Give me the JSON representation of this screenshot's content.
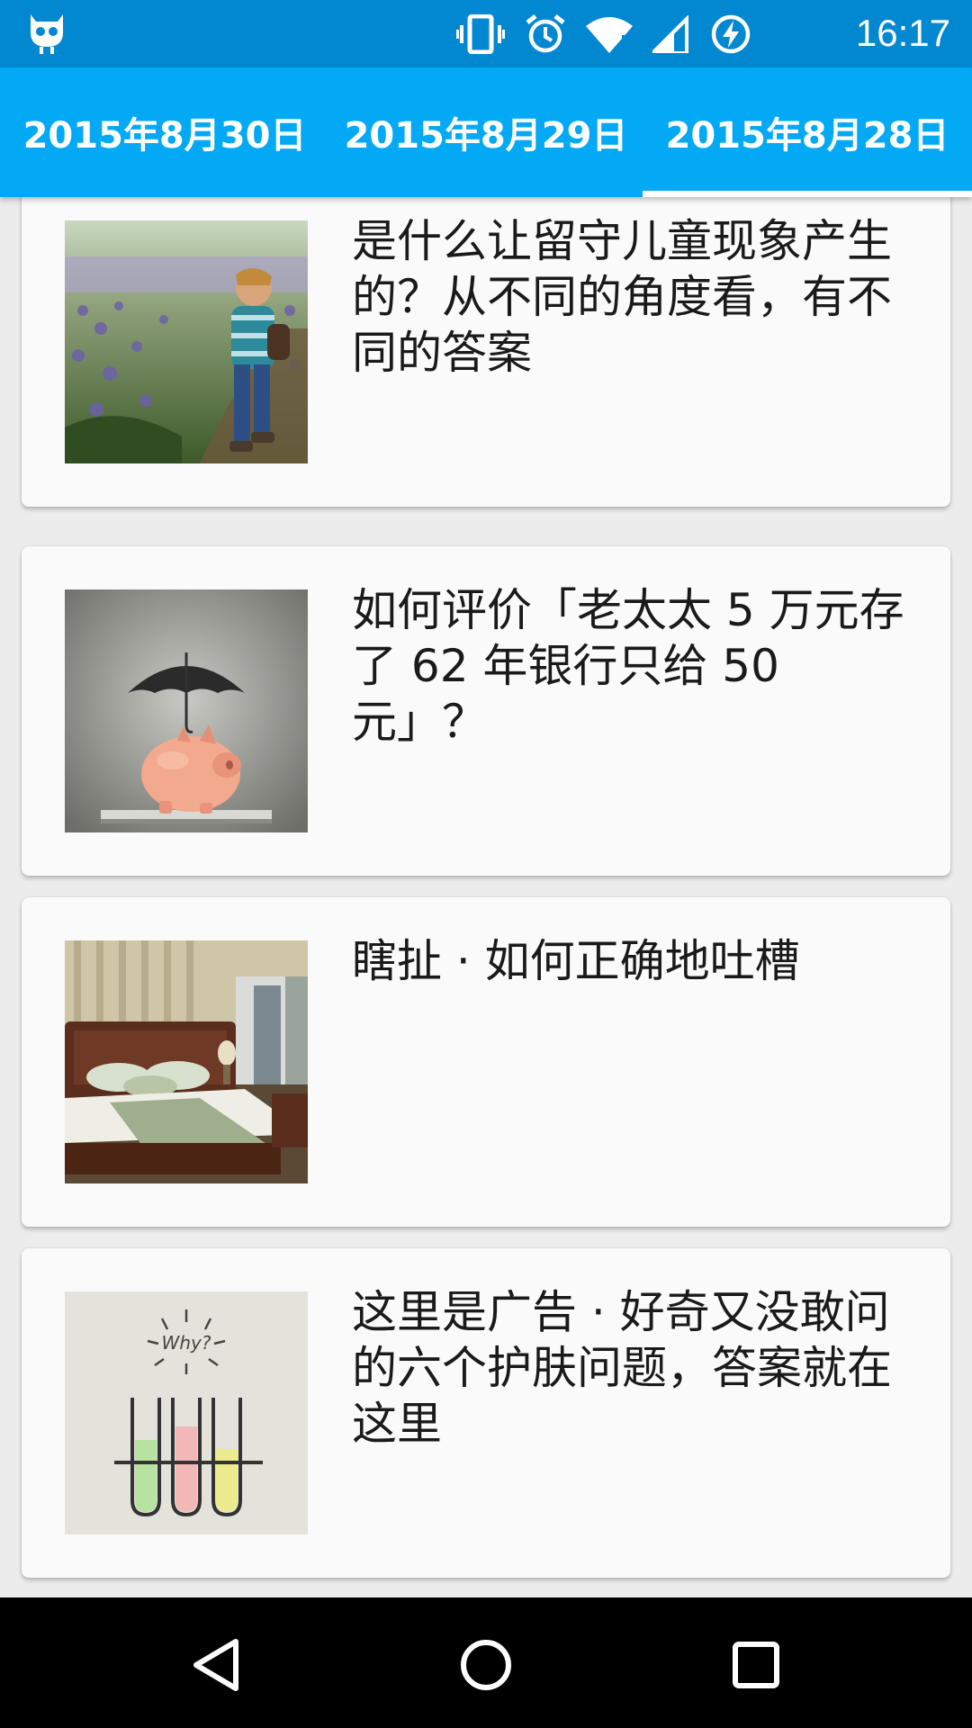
{
  "status_bar": {
    "time": "16:17",
    "icons": [
      "app-robot-icon",
      "vibrate-icon",
      "alarm-icon",
      "wifi-icon",
      "signal-icon",
      "battery-charging-icon"
    ]
  },
  "tabs": [
    {
      "label": "2015年8月30日",
      "selected": false
    },
    {
      "label": "2015年8月29日",
      "selected": false
    },
    {
      "label": "2015年8月28日",
      "selected": true
    }
  ],
  "stories": [
    {
      "title": "是什么让留守儿童现象产生的？从不同的角度看，有不同的答案",
      "image": "child-in-flower-field"
    },
    {
      "title": "如何评价「老太太 5 万元存了 62 年银行只给 50 元」？",
      "image": "piggy-bank-umbrella"
    },
    {
      "title": "瞎扯 · 如何正确地吐槽",
      "image": "bedroom"
    },
    {
      "title": "这里是广告 · 好奇又没敢问的六个护肤问题，答案就在这里",
      "image": "test-tubes-why"
    }
  ],
  "nav_bar": {
    "buttons": [
      "back-icon",
      "home-icon",
      "recents-icon"
    ]
  },
  "colors": {
    "status_bar": "#0288d1",
    "tab_bar": "#03a9f4",
    "card": "#fafafa",
    "background": "#ececec"
  }
}
